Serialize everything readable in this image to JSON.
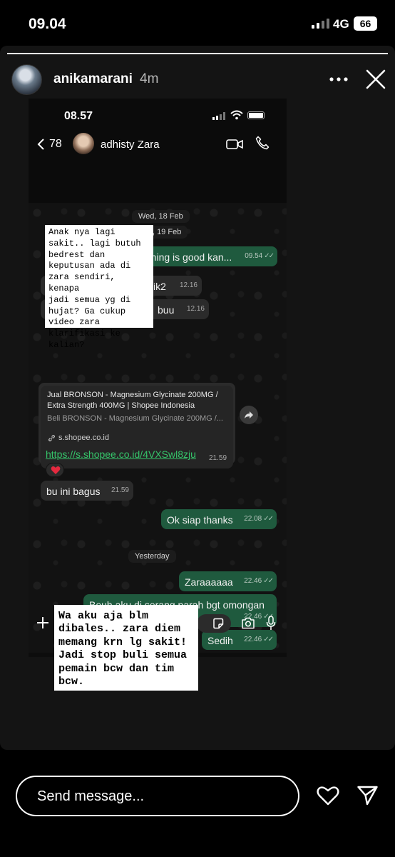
{
  "status_bar": {
    "time": "09.04",
    "network": "4G",
    "battery": "66"
  },
  "story": {
    "username": "anikamarani",
    "posted_ago": "4m",
    "progress": 1.0,
    "more_icon": "more-horizontal-icon",
    "close_icon": "close-icon"
  },
  "screenshot": {
    "status_time": "08.57",
    "back_count": "78",
    "contact_name": "adhisty Zara",
    "date_labels": {
      "wed": "Wed, 18 Feb",
      "thu": "Thu, 19 Feb",
      "yesterday": "Yesterday"
    },
    "messages": {
      "m1": {
        "text": "Everything is good kan...",
        "time": "09.54"
      },
      "m2": {
        "text": "ik2",
        "time": "12.16"
      },
      "m3": {
        "text": "buu",
        "time": "12.16"
      },
      "link_preview": {
        "title": "Jual BRONSON - Magnesium Glycinate 200MG / Extra Strength 400MG | Shopee Indonesia",
        "description": "Beli BRONSON - Magnesium Glycinate 200MG /...",
        "domain": "s.shopee.co.id",
        "url": "https://s.shopee.co.id/4VXSwl8zju",
        "time": "21.59",
        "reaction": "❤️"
      },
      "m5": {
        "text": "bu ini bagus",
        "time": "21.59"
      },
      "m6": {
        "text": "Ok siap thanks",
        "time": "22.08"
      },
      "m7": {
        "text": "Zaraaaaaa",
        "time": "22.46"
      },
      "m8": {
        "text": "Beuh aku di serang parah bgt omongan negative",
        "time": "22.46"
      },
      "m9": {
        "text": "Sedih",
        "time": "22.46"
      }
    }
  },
  "overlays": {
    "note_top": "Anak nya lagi\nsakit.. lagi butuh\nbedrest dan\nkeputusan ada di\nzara sendiri, kenapa\njadi semua yg di\nhujat? Ga cukup\nvideo zara\nklarifikasi ke\nkalian?",
    "note_bottom": "Wa aku aja blm\ndibales.. zara diem\nmemang krn lg sakit!\nJadi stop buli semua\npemain bcw dan tim\nbcw."
  },
  "reply": {
    "placeholder": "Send message...",
    "like_icon": "heart-icon",
    "send_icon": "send-icon"
  }
}
